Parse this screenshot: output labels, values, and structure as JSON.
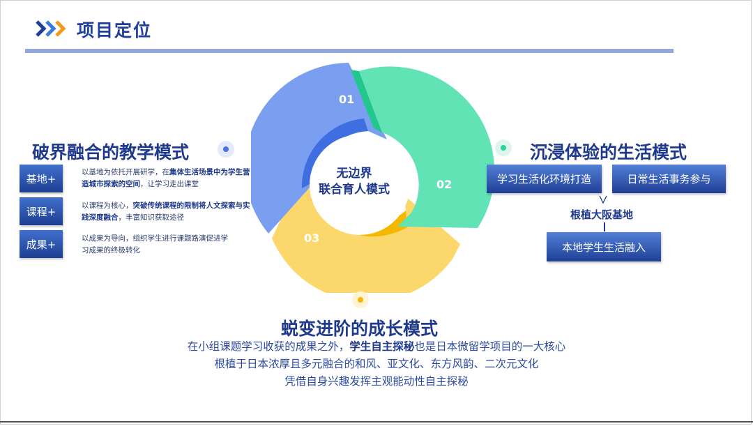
{
  "header": {
    "title": "项目定位",
    "logo_icon": "triple-chevron-icon"
  },
  "cycle": {
    "center_line1": "无边界",
    "center_line2": "联合育人模式",
    "num1": "01",
    "num2": "02",
    "num3": "03",
    "colors": {
      "seg1": "#7b9ff0",
      "seg2": "#62e3b6",
      "seg3": "#fcd86c",
      "inner_blue": "#3f6ee0",
      "inner_yellow": "#f5b800"
    }
  },
  "left": {
    "title": "破界融合的教学模式",
    "items": [
      {
        "tag": "基地+",
        "p1": "以基地为依托开展研学，在",
        "b1": "集体生活场景中为学生营造城市探索的空间",
        "p2": "，让学习走出课堂"
      },
      {
        "tag": "课程+",
        "p1": "以课程为核心，",
        "b1": "突破传统课程的限制将人文探索与实践深度融合",
        "p2": "，丰富知识获取途径"
      },
      {
        "tag": "成果+",
        "p1": "以成果为导向，组织学生进行课题路演促进学习成果的终极转化",
        "b1": "",
        "p2": ""
      }
    ]
  },
  "right": {
    "title": "沉浸体验的生活模式",
    "box1": "学习生活化环境打造",
    "box2": "日常生活事务参与",
    "base_label": "根植大阪基地",
    "box3": "本地学生生活融入"
  },
  "bottom": {
    "title": "蜕变进阶的成长模式",
    "line1_a": "在小组课题学习收获的成果之外，",
    "line1_b": "学生自主探秘",
    "line1_c": "也是日本微留学项目的一大核心",
    "line2": "根植于日本浓厚且多元融合的和风、亚文化、东方风韵、二次元文化",
    "line3": "凭借自身兴趣发挥主观能动性自主探秘"
  }
}
